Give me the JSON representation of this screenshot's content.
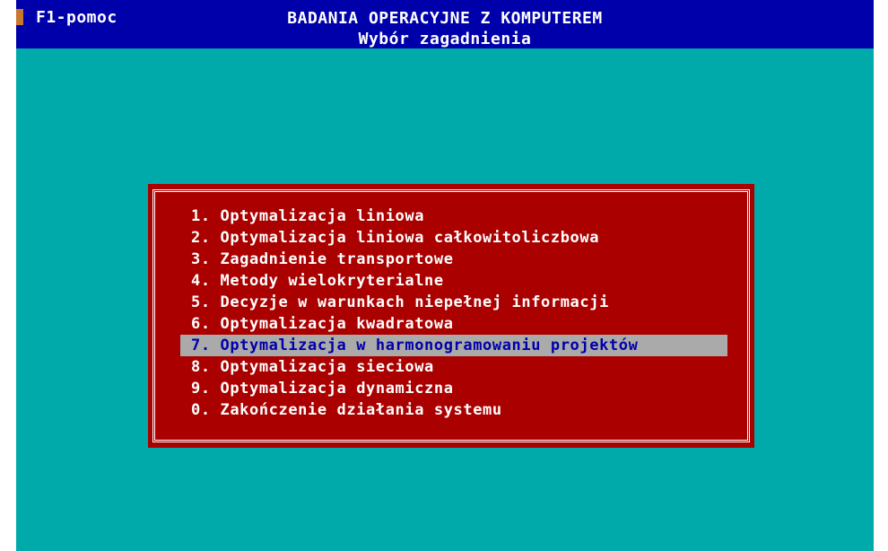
{
  "header": {
    "help_label": "F1-pomoc",
    "title": "BADANIA OPERACYJNE Z KOMPUTEREM",
    "subtitle": "Wybór zagadnienia"
  },
  "menu": {
    "items": [
      {
        "label": "1. Optymalizacja liniowa"
      },
      {
        "label": "2. Optymalizacja liniowa całkowitoliczbowa"
      },
      {
        "label": "3. Zagadnienie transportowe"
      },
      {
        "label": "4. Metody wielokryterialne"
      },
      {
        "label": "5. Decyzje w warunkach niepełnej informacji"
      },
      {
        "label": "6. Optymalizacja kwadratowa"
      },
      {
        "label": "7. Optymalizacja w harmonogramowaniu projektów"
      },
      {
        "label": "8. Optymalizacja sieciowa"
      },
      {
        "label": "9. Optymalizacja dynamiczna"
      },
      {
        "label": "0. Zakończenie działania systemu"
      }
    ],
    "selected_index": 6
  },
  "colors": {
    "background": "#00aaaa",
    "topbar": "#0000aa",
    "menu_bg": "#aa0000",
    "highlight_bg": "#aaaaaa",
    "highlight_text": "#0000aa"
  }
}
